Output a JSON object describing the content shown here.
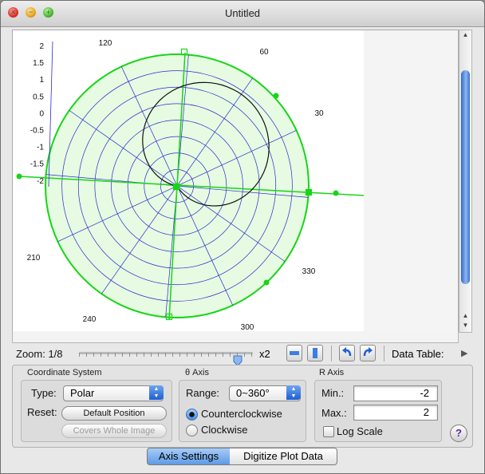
{
  "window": {
    "title": "Untitled"
  },
  "plot": {
    "r_ticks": [
      "2",
      "1.5",
      "1",
      "0.5",
      "0",
      "-0.5",
      "-1",
      "-1.5",
      "-2"
    ],
    "theta_labels": [
      "120",
      "60",
      "30",
      "210",
      "240",
      "330",
      "300"
    ]
  },
  "toolbar": {
    "zoom_label": "Zoom: 1/8",
    "zoom_max": "x2",
    "data_table_label": "Data Table:"
  },
  "coordinate_system": {
    "title": "Coordinate System",
    "type_label": "Type:",
    "type_value": "Polar",
    "reset_label": "Reset:",
    "default_position": "Default Position",
    "covers_whole_image": "Covers Whole Image"
  },
  "theta_axis": {
    "title": "θ Axis",
    "range_label": "Range:",
    "range_value": "0~360°",
    "ccw": "Counterclockwise",
    "cw": "Clockwise",
    "direction": "Counterclockwise"
  },
  "r_axis": {
    "title": "R Axis",
    "min_label": "Min.:",
    "min_value": "-2",
    "max_label": "Max.:",
    "max_value": "2",
    "log_scale": "Log Scale",
    "log_checked": false
  },
  "help": {
    "label": "?"
  },
  "tabs": [
    {
      "label": "Axis Settings",
      "selected": true
    },
    {
      "label": "Digitize Plot Data",
      "selected": false
    }
  ],
  "colors": {
    "axis_green": "#17d517",
    "grid_blue": "#2a2acf",
    "plot_fill": "#e6fbe1",
    "curve": "#111111",
    "accent": "#3b7be0"
  }
}
